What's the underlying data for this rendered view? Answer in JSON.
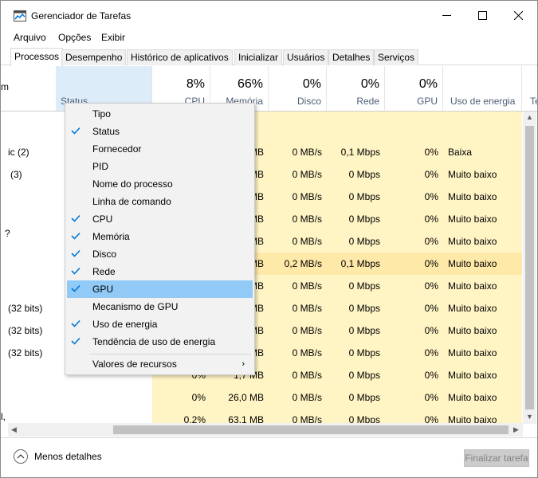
{
  "window": {
    "title": "Gerenciador de Tarefas"
  },
  "menu": [
    "Arquivo",
    "Opções",
    "Exibir"
  ],
  "tabs": [
    "Processos",
    "Desempenho",
    "Histórico de aplicativos",
    "Inicializar",
    "Usuários",
    "Detalhes",
    "Serviços"
  ],
  "headers": {
    "status": "Status",
    "cpu": {
      "pct": "8%",
      "label": "CPU"
    },
    "memoria": {
      "pct": "66%",
      "label": "Memória"
    },
    "disco": {
      "pct": "0%",
      "label": "Disco"
    },
    "rede": {
      "pct": "0%",
      "label": "Rede"
    },
    "gpu": {
      "pct": "0%",
      "label": "GPU"
    },
    "energia": {
      "label": "Uso de energia"
    },
    "tendencia": {
      "label": "Te"
    }
  },
  "left_fragments": [
    "m",
    "ic (2)",
    "(3)",
    "?",
    "(32 bits)",
    "(32 bits)",
    "(32 bits)",
    "l,"
  ],
  "rows": [
    {
      "mem": "MB",
      "disco": "0 MB/s",
      "rede": "0,1 Mbps",
      "gpu": "0%",
      "energia": "Baixa"
    },
    {
      "mem": "MB",
      "disco": "0 MB/s",
      "rede": "0 Mbps",
      "gpu": "0%",
      "energia": "Muito baixo"
    },
    {
      "mem": "MB",
      "disco": "0 MB/s",
      "rede": "0 Mbps",
      "gpu": "0%",
      "energia": "Muito baixo"
    },
    {
      "mem": "MB",
      "disco": "0 MB/s",
      "rede": "0 Mbps",
      "gpu": "0%",
      "energia": "Muito baixo"
    },
    {
      "mem": "MB",
      "disco": "0 MB/s",
      "rede": "0 Mbps",
      "gpu": "0%",
      "energia": "Muito baixo"
    },
    {
      "mem": "MB",
      "disco": "0,2 MB/s",
      "rede": "0,1 Mbps",
      "gpu": "0%",
      "energia": "Muito baixo"
    },
    {
      "mem": "MB",
      "disco": "0 MB/s",
      "rede": "0 Mbps",
      "gpu": "0%",
      "energia": "Muito baixo"
    },
    {
      "mem": "MB",
      "disco": "0 MB/s",
      "rede": "0 Mbps",
      "gpu": "0%",
      "energia": "Muito baixo"
    },
    {
      "mem": "MB",
      "disco": "0 MB/s",
      "rede": "0 Mbps",
      "gpu": "0%",
      "energia": "Muito baixo"
    },
    {
      "mem": "MB",
      "disco": "0 MB/s",
      "rede": "0 Mbps",
      "gpu": "0%",
      "energia": "Muito baixo"
    },
    {
      "cpu": "0%",
      "mem": "1,7 MB",
      "disco": "0 MB/s",
      "rede": "0 Mbps",
      "gpu": "0%",
      "energia": "Muito baixo"
    },
    {
      "cpu": "0%",
      "mem": "26,0 MB",
      "disco": "0 MB/s",
      "rede": "0 Mbps",
      "gpu": "0%",
      "energia": "Muito baixo"
    },
    {
      "cpu": "0,2%",
      "mem": "63,1 MB",
      "disco": "0 MB/s",
      "rede": "0 Mbps",
      "gpu": "0%",
      "energia": "Muito baixo"
    }
  ],
  "context_menu": [
    {
      "label": "Tipo",
      "checked": false
    },
    {
      "label": "Status",
      "checked": true
    },
    {
      "label": "Fornecedor",
      "checked": false
    },
    {
      "label": "PID",
      "checked": false
    },
    {
      "label": "Nome do processo",
      "checked": false
    },
    {
      "label": "Linha de comando",
      "checked": false
    },
    {
      "label": "CPU",
      "checked": true
    },
    {
      "label": "Memória",
      "checked": true
    },
    {
      "label": "Disco",
      "checked": true
    },
    {
      "label": "Rede",
      "checked": true
    },
    {
      "label": "GPU",
      "checked": true,
      "highlighted": true
    },
    {
      "label": "Mecanismo de GPU",
      "checked": false
    },
    {
      "label": "Uso de energia",
      "checked": true
    },
    {
      "label": "Tendência de uso de energia",
      "checked": true
    }
  ],
  "context_submenu": {
    "label": "Valores de recursos"
  },
  "footer": {
    "fewer_details": "Menos detalhes",
    "end_task": "Finalizar tarefa"
  },
  "colors": {
    "accent": "#0078d7",
    "highlight": "#91c9f7",
    "cell_bg": "#fff4c4",
    "cell_bg_hot": "#ffe9a8"
  }
}
